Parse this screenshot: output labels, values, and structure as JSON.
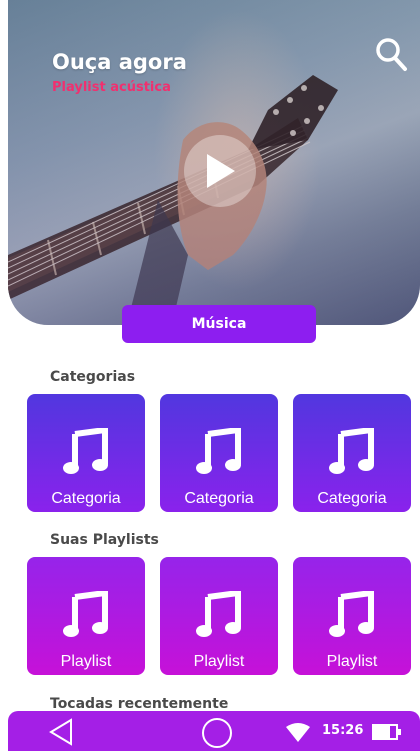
{
  "hero": {
    "title": "Ouça agora",
    "subtitle": "Playlist acústica",
    "tab_label": "Música",
    "icons": {
      "search": "search-icon",
      "play": "play-icon"
    }
  },
  "categories": {
    "title": "Categorias",
    "items": [
      {
        "label": "Categoria",
        "icon": "music-note-icon"
      },
      {
        "label": "Categoria",
        "icon": "music-note-icon"
      },
      {
        "label": "Categoria",
        "icon": "music-note-icon"
      }
    ]
  },
  "playlists": {
    "title": "Suas Playlists",
    "items": [
      {
        "label": "Playlist",
        "icon": "music-note-icon"
      },
      {
        "label": "Playlist",
        "icon": "music-note-icon"
      },
      {
        "label": "Playlist",
        "icon": "music-note-icon"
      }
    ]
  },
  "recent": {
    "title": "Tocadas recentemente"
  },
  "status_bar": {
    "time": "15:26",
    "icons": {
      "back": "back-triangle-icon",
      "home": "home-circle-icon",
      "wifi": "wifi-icon",
      "battery": "battery-icon"
    }
  },
  "colors": {
    "accent": "#8d1ef0",
    "subtitle": "#f0306f",
    "category_gradient": [
      "#5137df",
      "#8a22ec"
    ],
    "playlist_gradient": [
      "#9624ea",
      "#c611d8"
    ],
    "nav_bar": "#a41fe6"
  }
}
